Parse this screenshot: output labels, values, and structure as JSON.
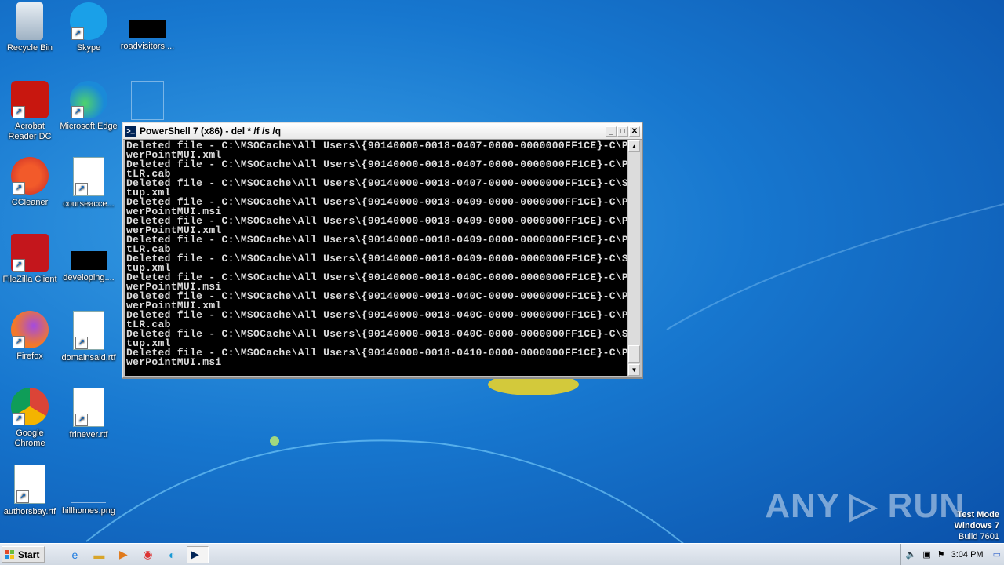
{
  "desktop": {
    "icons": [
      {
        "label": "Recycle Bin",
        "icon": "recycle-bin-icon"
      },
      {
        "label": "Skype",
        "icon": "skype-icon"
      },
      {
        "label": "roadvisitors....",
        "icon": "black-file-icon"
      },
      {
        "label": "Acrobat Reader DC",
        "icon": "acrobat-icon"
      },
      {
        "label": "Microsoft Edge",
        "icon": "edge-icon"
      },
      {
        "label": "",
        "icon": "blank-file-icon"
      },
      {
        "label": "CCleaner",
        "icon": "ccleaner-icon"
      },
      {
        "label": "courseacce...",
        "icon": "word-doc-icon"
      },
      {
        "label": "FileZilla Client",
        "icon": "filezilla-icon"
      },
      {
        "label": "developing....",
        "icon": "black-file-icon"
      },
      {
        "label": "Firefox",
        "icon": "firefox-icon"
      },
      {
        "label": "domainsaid.rtf",
        "icon": "word-doc-icon"
      },
      {
        "label": "Google Chrome",
        "icon": "chrome-icon"
      },
      {
        "label": "frinever.rtf",
        "icon": "word-doc-icon"
      },
      {
        "label": "authorsbay.rtf",
        "icon": "word-doc-icon"
      },
      {
        "label": "hillhomes.png",
        "icon": "image-file-icon"
      }
    ]
  },
  "window": {
    "title": "PowerShell 7 (x86) - del  * /f /s /q",
    "minimize": "_",
    "maximize": "□",
    "close": "✕",
    "lines": [
      "Deleted file - C:\\MSOCache\\All Users\\{90140000-0018-0407-0000-0000000FF1CE}-C\\Po",
      "werPointMUI.xml",
      "Deleted file - C:\\MSOCache\\All Users\\{90140000-0018-0407-0000-0000000FF1CE}-C\\Pp",
      "tLR.cab",
      "Deleted file - C:\\MSOCache\\All Users\\{90140000-0018-0407-0000-0000000FF1CE}-C\\Se",
      "tup.xml",
      "Deleted file - C:\\MSOCache\\All Users\\{90140000-0018-0409-0000-0000000FF1CE}-C\\Po",
      "werPointMUI.msi",
      "Deleted file - C:\\MSOCache\\All Users\\{90140000-0018-0409-0000-0000000FF1CE}-C\\Po",
      "werPointMUI.xml",
      "Deleted file - C:\\MSOCache\\All Users\\{90140000-0018-0409-0000-0000000FF1CE}-C\\Pp",
      "tLR.cab",
      "Deleted file - C:\\MSOCache\\All Users\\{90140000-0018-0409-0000-0000000FF1CE}-C\\Se",
      "tup.xml",
      "Deleted file - C:\\MSOCache\\All Users\\{90140000-0018-040C-0000-0000000FF1CE}-C\\Po",
      "werPointMUI.msi",
      "Deleted file - C:\\MSOCache\\All Users\\{90140000-0018-040C-0000-0000000FF1CE}-C\\Po",
      "werPointMUI.xml",
      "Deleted file - C:\\MSOCache\\All Users\\{90140000-0018-040C-0000-0000000FF1CE}-C\\Pp",
      "tLR.cab",
      "Deleted file - C:\\MSOCache\\All Users\\{90140000-0018-040C-0000-0000000FF1CE}-C\\Se",
      "tup.xml",
      "Deleted file - C:\\MSOCache\\All Users\\{90140000-0018-0410-0000-0000000FF1CE}-C\\Po",
      "werPointMUI.msi"
    ]
  },
  "taskbar": {
    "start_label": "Start",
    "clock": "3:04 PM",
    "pinned": [
      "ie-icon",
      "explorer-icon",
      "media-player-icon",
      "chrome-icon",
      "edge-icon",
      "powershell-icon"
    ]
  },
  "watermark": "ANY ▷ RUN",
  "testmode": {
    "line1": "Test Mode",
    "line2": "Windows 7",
    "line3": "Build 7601"
  },
  "colors": {
    "console_bg": "#000000",
    "console_fg": "#dcdcdc",
    "desktop": "#1777cf"
  }
}
